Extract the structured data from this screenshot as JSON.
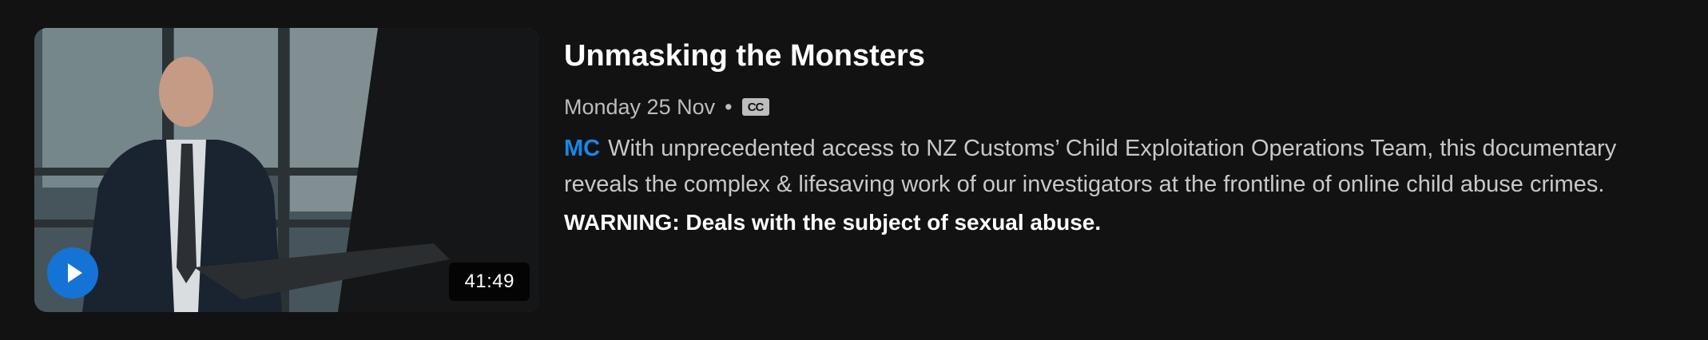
{
  "episode": {
    "title": "Unmasking the Monsters",
    "air_date": "Monday 25 Nov",
    "separator": "•",
    "cc_label": "CC",
    "rating": "MC",
    "description": "With unprecedented access to NZ Customs’ Child Exploitation Operations Team, this documentary reveals the complex & lifesaving work of our investigators at the frontline of online child abuse crimes.",
    "warning": "WARNING: Deals with the subject of sexual abuse.",
    "duration": "41:49",
    "play_icon": "play-icon",
    "colors": {
      "accent": "#1673d6",
      "rating": "#1a86e8",
      "background": "#121212"
    }
  }
}
